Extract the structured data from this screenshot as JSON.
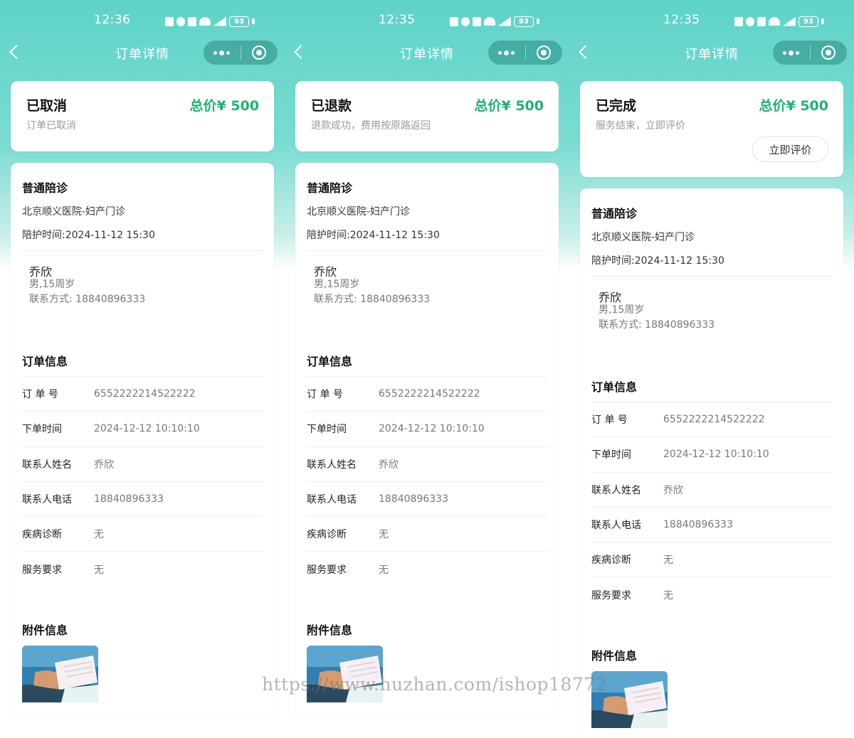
{
  "screens": [
    {
      "status_bar": {
        "time": "12:36",
        "battery": "93"
      },
      "nav": {
        "title": "订单详情"
      },
      "status": {
        "title": "已取消",
        "total": "总价¥ 500",
        "desc": "订单已取消"
      },
      "service": {
        "title": "普通陪诊",
        "hospital": "北京顺义医院-妇产门诊",
        "time": "陪护时间:2024-11-12 15:30",
        "patient": {
          "name": "乔欣",
          "meta": "男,15周岁",
          "contact": "联系方式:  18840896333"
        }
      },
      "order_info": {
        "title": "订单信息",
        "rows": [
          {
            "label": "订 单 号",
            "value": "6552222214522222"
          },
          {
            "label": "下单时间",
            "value": "2024-12-12 10:10:10"
          },
          {
            "label": "联系人姓名",
            "value": "乔欣"
          },
          {
            "label": "联系人电话",
            "value": "18840896333"
          },
          {
            "label": "疾病诊断",
            "value": "无"
          },
          {
            "label": "服务要求",
            "value": "无"
          }
        ]
      },
      "attachments": {
        "title": "附件信息"
      }
    },
    {
      "status_bar": {
        "time": "12:35",
        "battery": "93"
      },
      "nav": {
        "title": "订单详情"
      },
      "status": {
        "title": "已退款",
        "total": "总价¥ 500",
        "desc": "退款成功，费用按原路返回"
      },
      "service": {
        "title": "普通陪诊",
        "hospital": "北京顺义医院-妇产门诊",
        "time": "陪护时间:2024-11-12 15:30",
        "patient": {
          "name": "乔欣",
          "meta": "男,15周岁",
          "contact": "联系方式:  18840896333"
        }
      },
      "order_info": {
        "title": "订单信息",
        "rows": [
          {
            "label": "订 单 号",
            "value": "6552222214522222"
          },
          {
            "label": "下单时间",
            "value": "2024-12-12 10:10:10"
          },
          {
            "label": "联系人姓名",
            "value": "乔欣"
          },
          {
            "label": "联系人电话",
            "value": "18840896333"
          },
          {
            "label": "疾病诊断",
            "value": "无"
          },
          {
            "label": "服务要求",
            "value": "无"
          }
        ]
      },
      "attachments": {
        "title": "附件信息"
      }
    },
    {
      "status_bar": {
        "time": "12:35",
        "battery": "93"
      },
      "nav": {
        "title": "订单详情"
      },
      "status": {
        "title": "已完成",
        "total": "总价¥ 500",
        "desc": "服务结束，立即评价",
        "action_label": "立即评价"
      },
      "service": {
        "title": "普通陪诊",
        "hospital": "北京顺义医院-妇产门诊",
        "time": "陪护时间:2024-11-12 15:30",
        "patient": {
          "name": "乔欣",
          "meta": "男,15周岁",
          "contact": "联系方式:  18840896333"
        }
      },
      "order_info": {
        "title": "订单信息",
        "rows": [
          {
            "label": "订 单 号",
            "value": "6552222214522222"
          },
          {
            "label": "下单时间",
            "value": "2024-12-12 10:10:10"
          },
          {
            "label": "联系人姓名",
            "value": "乔欣"
          },
          {
            "label": "联系人电话",
            "value": "18840896333"
          },
          {
            "label": "疾病诊断",
            "value": "无"
          },
          {
            "label": "服务要求",
            "value": "无"
          }
        ]
      },
      "attachments": {
        "title": "附件信息"
      }
    }
  ],
  "watermark": "https://www.huzhan.com/ishop18772",
  "colors": {
    "accent_green": "#1cb36f",
    "header_teal": "#5fd3c9"
  }
}
